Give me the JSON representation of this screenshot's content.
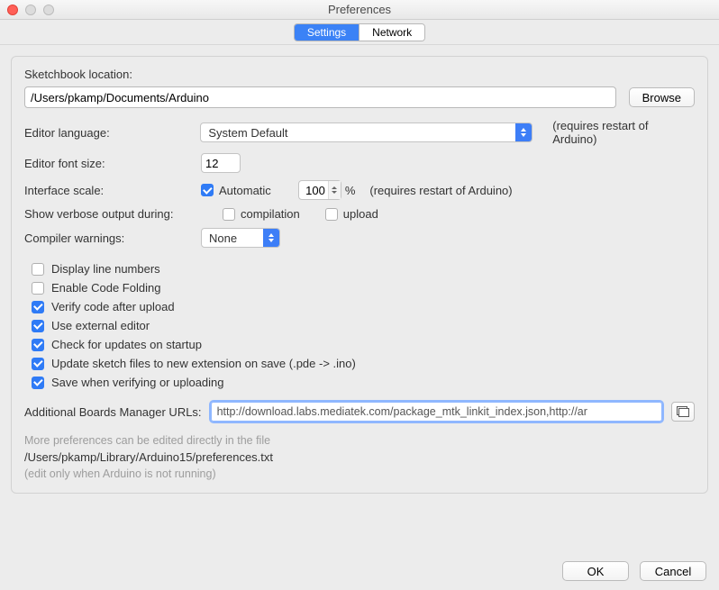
{
  "window": {
    "title": "Preferences"
  },
  "tabs": {
    "settings": "Settings",
    "network": "Network"
  },
  "sketchbook": {
    "label": "Sketchbook location:",
    "value": "/Users/pkamp/Documents/Arduino",
    "browse": "Browse"
  },
  "editor_language": {
    "label": "Editor language:",
    "value": "System Default",
    "note": "(requires restart of Arduino)"
  },
  "font_size": {
    "label": "Editor font size:",
    "value": "12"
  },
  "interface_scale": {
    "label": "Interface scale:",
    "automatic": "Automatic",
    "value": "100",
    "percent": "%",
    "note": "(requires restart of Arduino)"
  },
  "verbose": {
    "label": "Show verbose output during:",
    "compilation": "compilation",
    "upload": "upload"
  },
  "compiler_warnings": {
    "label": "Compiler warnings:",
    "value": "None"
  },
  "options": {
    "display_line_numbers": "Display line numbers",
    "enable_code_folding": "Enable Code Folding",
    "verify_after_upload": "Verify code after upload",
    "external_editor": "Use external editor",
    "check_updates": "Check for updates on startup",
    "update_extension": "Update sketch files to new extension on save (.pde -> .ino)",
    "save_on_verify": "Save when verifying or uploading"
  },
  "boards_urls": {
    "label": "Additional Boards Manager URLs:",
    "value": "http://download.labs.mediatek.com/package_mtk_linkit_index.json,http://ar"
  },
  "more_prefs": {
    "line1": "More preferences can be edited directly in the file",
    "path": "/Users/pkamp/Library/Arduino15/preferences.txt",
    "line2": "(edit only when Arduino is not running)"
  },
  "buttons": {
    "ok": "OK",
    "cancel": "Cancel"
  }
}
